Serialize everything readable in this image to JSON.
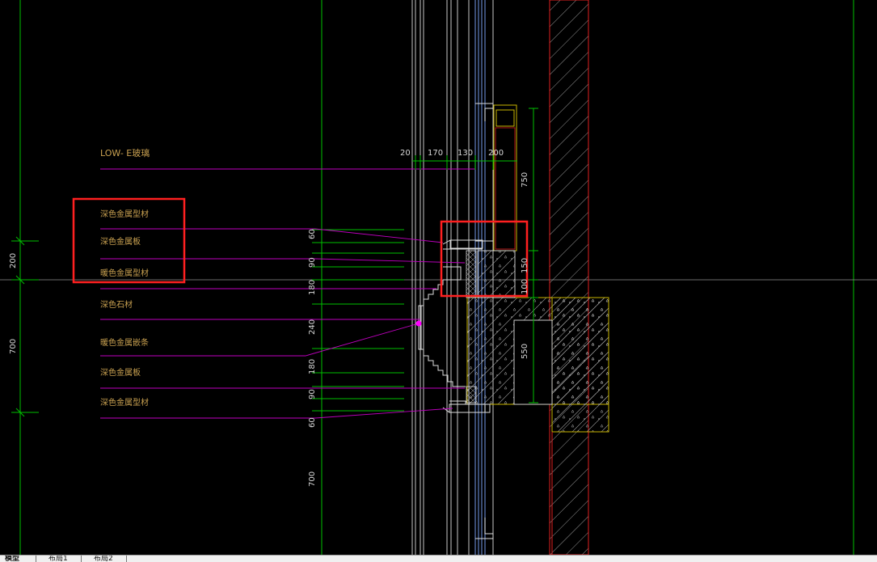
{
  "drawing": {
    "glass_label": "LOW- E玻璃",
    "material_labels": [
      "深色金属型材",
      "深色金属板",
      "暖色金属型材",
      "深色石材",
      "暖色金属嵌条",
      "深色金属板",
      "深色金属型材"
    ],
    "top_dims": [
      "20",
      "170",
      "130",
      "200"
    ],
    "left_dims": [
      "200",
      "700"
    ],
    "stack_dims": [
      "60",
      "90",
      "180",
      "240",
      "180",
      "90",
      "60",
      "700"
    ],
    "right_dims": [
      "750",
      "150",
      "100",
      "550"
    ]
  },
  "tabs": {
    "model": "模型",
    "layout1": "布局1",
    "layout2": "布局2"
  },
  "colors": {
    "background": "#000000",
    "grid_line": "#00c000",
    "leader_line": "#c000c0",
    "label_text": "#c8a050",
    "dim_text": "#d8d8d8",
    "profile_line": "#6080c0",
    "red_line": "#e02020",
    "yellow_line": "#c8b400",
    "highlight_box": "#ff2020"
  }
}
